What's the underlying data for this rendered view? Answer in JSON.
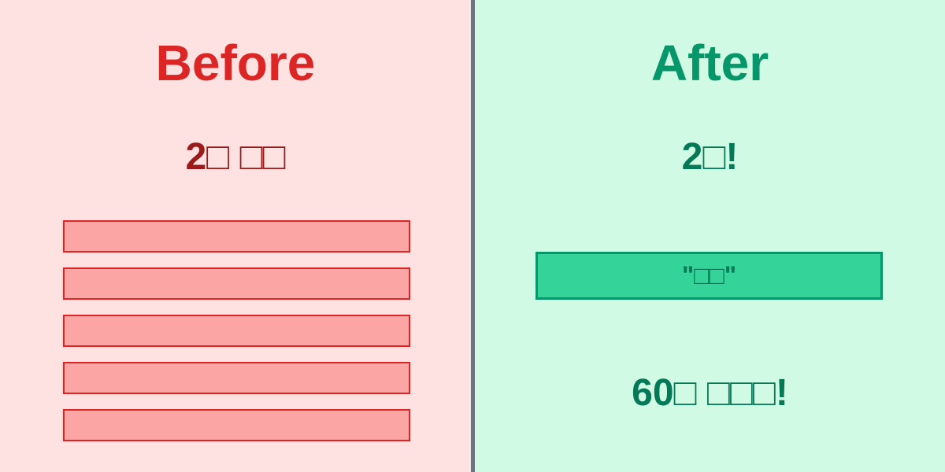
{
  "before": {
    "title": "Before",
    "subtitle": "2□ □□",
    "bar_count": 5,
    "colors": {
      "heading": "#dc2626",
      "background": "#fee2e2",
      "bar_fill": "#fca5a5"
    }
  },
  "after": {
    "title": "After",
    "subtitle": "2□!",
    "highlight_label": "\"□□\"",
    "bottom_text": "60□ □□□!",
    "colors": {
      "heading": "#059669",
      "background": "#d1fae5",
      "highlight_fill": "#34d399"
    }
  }
}
